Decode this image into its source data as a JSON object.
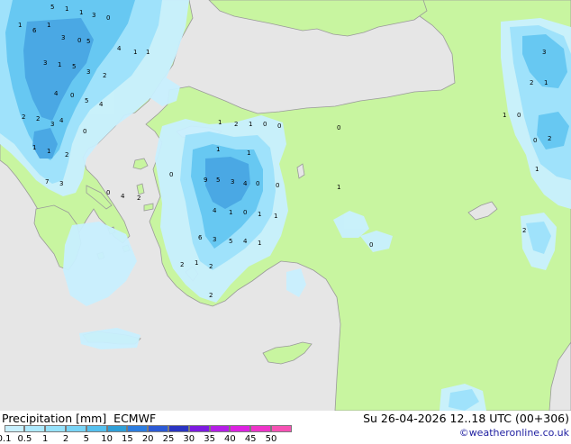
{
  "title": {
    "field": "Precipitation [mm]",
    "model": "ECMWF"
  },
  "valid_time": "Su 26-04-2026 12..18 UTC (00+306)",
  "credit": "©weatheronline.co.uk",
  "legend": {
    "ticks": [
      "0.1",
      "0.5",
      "1",
      "2",
      "5",
      "10",
      "15",
      "20",
      "25",
      "30",
      "35",
      "40",
      "45",
      "50"
    ],
    "colors": [
      "#c8f0ff",
      "#aeeaff",
      "#96e2fb",
      "#78d4f6",
      "#54c0ee",
      "#2f9fd7",
      "#2c7de0",
      "#2c5ad5",
      "#2a34c2",
      "#7d1be0",
      "#b41ee6",
      "#dc22e1",
      "#ee34c9",
      "#f652b4"
    ]
  },
  "map_colors": {
    "land": "#c8f5a0",
    "sea": "#e6e6e6",
    "precip_light": "#c9f0ff",
    "precip_mid": "#9fe2fb",
    "precip_strong": "#67c8f2",
    "precip_heavy": "#4aa8e4",
    "outline": "#9a9a9a",
    "dot_label": "#000000"
  },
  "map_labels": {
    "rain_values": [
      "5",
      "1",
      "3",
      "0",
      "1",
      "1",
      "3",
      "6",
      "0",
      "5",
      "4",
      "1",
      "1",
      "3",
      "1",
      "5",
      "2",
      "3",
      "4",
      "0",
      "4",
      "5",
      "2",
      "0",
      "4",
      "2",
      "3",
      "1",
      "2",
      "7",
      "3",
      "1",
      "1",
      "0",
      "4",
      "2",
      "1",
      "2",
      "1",
      "0",
      "0",
      "0",
      "1",
      "1",
      "0",
      "9",
      "5",
      "3",
      "4",
      "0",
      "0",
      "1",
      "4",
      "1",
      "0",
      "1",
      "1",
      "6",
      "3",
      "5",
      "4",
      "1",
      "2",
      "1",
      "2",
      "2",
      "3",
      "2",
      "1",
      "1",
      "0",
      "0",
      "2",
      "1",
      "2",
      "0"
    ]
  }
}
